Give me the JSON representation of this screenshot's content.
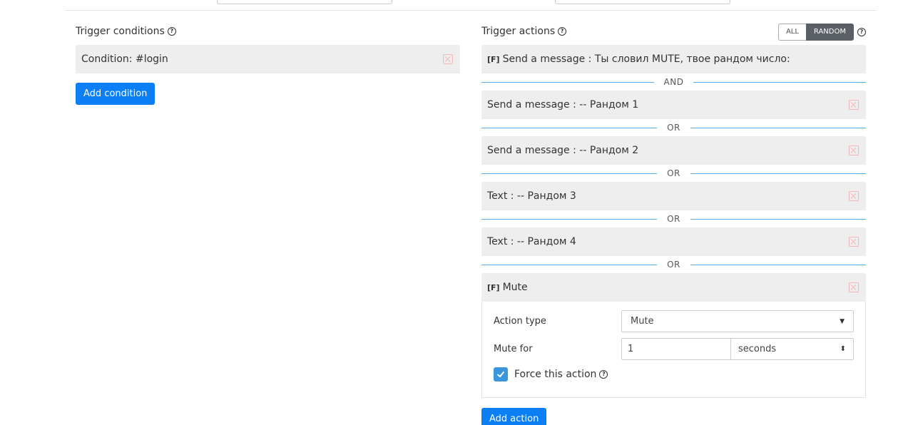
{
  "conditions": {
    "title": "Trigger conditions",
    "items": [
      {
        "label": "Condition: #login"
      }
    ],
    "add_label": "Add condition"
  },
  "actions": {
    "title": "Trigger actions",
    "mode": {
      "all_label": "ALL",
      "random_label": "RANDOM",
      "selected": "RANDOM"
    },
    "items": [
      {
        "tag": "[F]",
        "label": "Send a message : Ты словил MUTE, твое рандом число:"
      },
      {
        "separator": "AND",
        "label": "Send a message : -- Рандом 1"
      },
      {
        "separator": "OR",
        "label": "Send a message : -- Рандом 2"
      },
      {
        "separator": "OR",
        "label": "Text : -- Рандом 3"
      },
      {
        "separator": "OR",
        "label": "Text : -- Рандом 4"
      },
      {
        "separator": "OR",
        "tag": "[F]",
        "label": "Mute"
      }
    ],
    "expanded": {
      "action_type_label": "Action type",
      "action_type_value": "Mute",
      "mute_for_label": "Mute for",
      "mute_for_value": "1",
      "mute_unit": "seconds",
      "force_label": "Force this action",
      "force_checked": true
    },
    "add_label": "Add action"
  },
  "colors": {
    "primary": "#0d7ff5",
    "row_bg": "#eeeeee",
    "separator": "#5aa9e6",
    "delete_icon": "#f3b6b6",
    "checkbox": "#3a96dd"
  }
}
